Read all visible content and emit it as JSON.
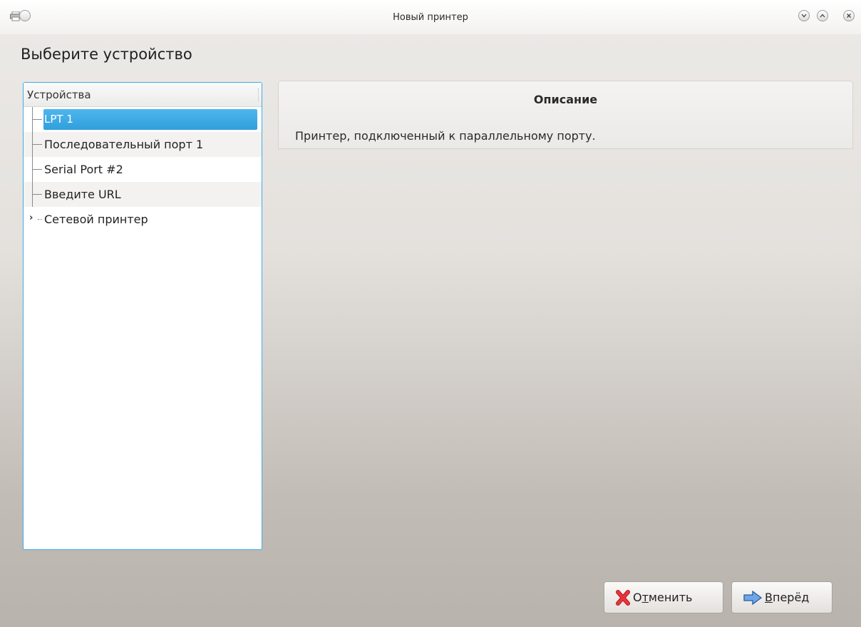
{
  "window": {
    "title": "Новый принтер"
  },
  "page": {
    "heading": "Выберите устройство"
  },
  "tree": {
    "header": "Устройства",
    "items": [
      {
        "label": "LPT 1",
        "selected": true
      },
      {
        "label": "Последовательный порт 1"
      },
      {
        "label": "Serial Port #2"
      },
      {
        "label": "Введите URL"
      },
      {
        "label": "Сетевой принтер",
        "expandable": true
      }
    ]
  },
  "description": {
    "title": "Описание",
    "text": "Принтер, подключенный к параллельному порту."
  },
  "buttons": {
    "cancel": {
      "pre": "О",
      "mnemonic": "т",
      "post": "менить"
    },
    "forward": {
      "pre": "",
      "mnemonic": "В",
      "post": "перёд"
    }
  },
  "colors": {
    "selection": "#3daee9",
    "cancel_icon": "#d9262c",
    "forward_icon": "#4a90d9"
  }
}
